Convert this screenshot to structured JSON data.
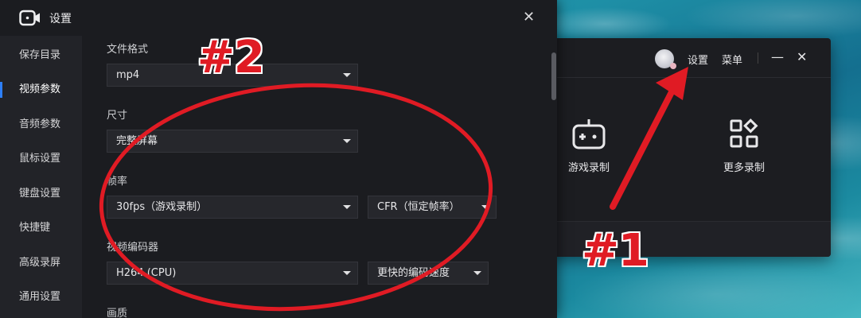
{
  "main_window": {
    "settings_label": "设置",
    "menu_label": "菜单",
    "minimize_glyph": "—",
    "close_glyph": "✕",
    "tiles": [
      {
        "label": "游戏录制",
        "icon": "gamepad-icon"
      },
      {
        "label": "更多录制",
        "icon": "grid-icon"
      }
    ]
  },
  "settings": {
    "title": "设置",
    "close_glyph": "✕",
    "sidebar": {
      "items": [
        {
          "label": "保存目录"
        },
        {
          "label": "视频参数",
          "active": true
        },
        {
          "label": "音频参数"
        },
        {
          "label": "鼠标设置"
        },
        {
          "label": "键盘设置"
        },
        {
          "label": "快捷键"
        },
        {
          "label": "高级录屏"
        },
        {
          "label": "通用设置"
        }
      ]
    },
    "fields": {
      "file_format": {
        "label": "文件格式",
        "value": "mp4"
      },
      "size": {
        "label": "尺寸",
        "value": "完整屏幕"
      },
      "frame_rate": {
        "label": "帧率",
        "value": "30fps（游戏录制）",
        "mode_value": "CFR（恒定帧率）"
      },
      "encoder": {
        "label": "视频编码器",
        "value": "H264 (CPU)",
        "speed_value": "更快的编码速度"
      },
      "quality": {
        "label": "画质"
      }
    }
  },
  "annotations": {
    "mark_1": "#1",
    "mark_2": "#2",
    "color": "#e01b24"
  }
}
